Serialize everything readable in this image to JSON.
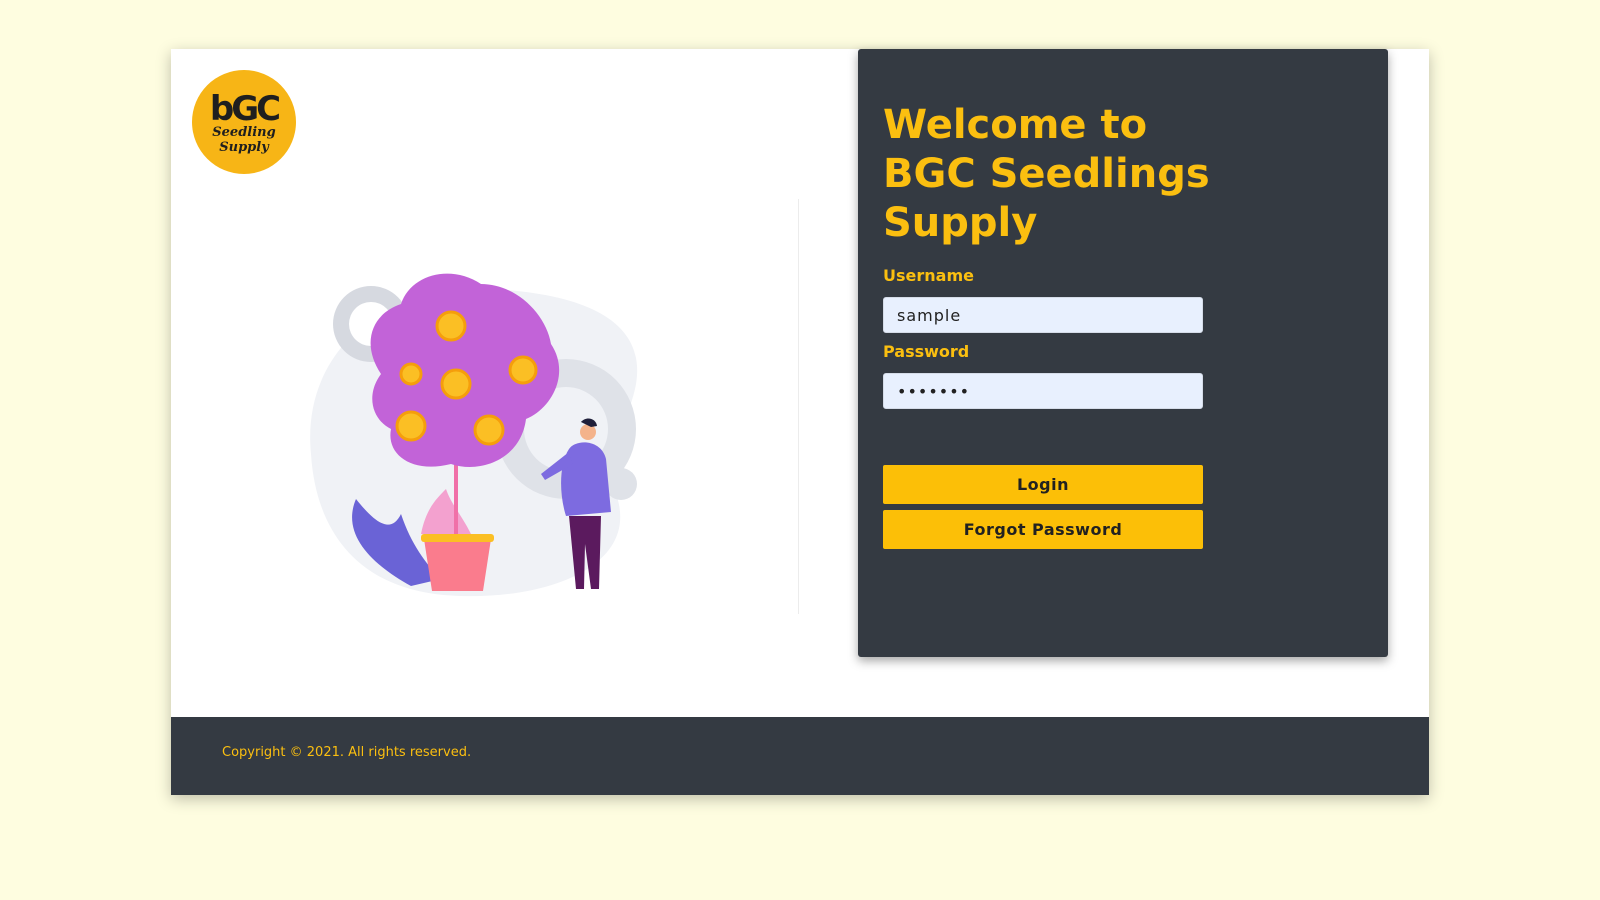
{
  "logo": {
    "main": "bGC",
    "line1": "Seedling",
    "line2": "Supply"
  },
  "login": {
    "title": "Welcome to BGC Seedlings Supply",
    "username_label": "Username",
    "username_value": "sample",
    "password_label": "Password",
    "password_value": "•••••••",
    "login_button": "Login",
    "forgot_button": "Forgot Password"
  },
  "footer": {
    "copyright": "Copyright © 2021. All rights reserved."
  },
  "colors": {
    "page_bg": "#fefde0",
    "panel": "#343a42",
    "accent": "#fbbf10",
    "button": "#fcbf07",
    "input_bg": "#e8f0fe"
  }
}
